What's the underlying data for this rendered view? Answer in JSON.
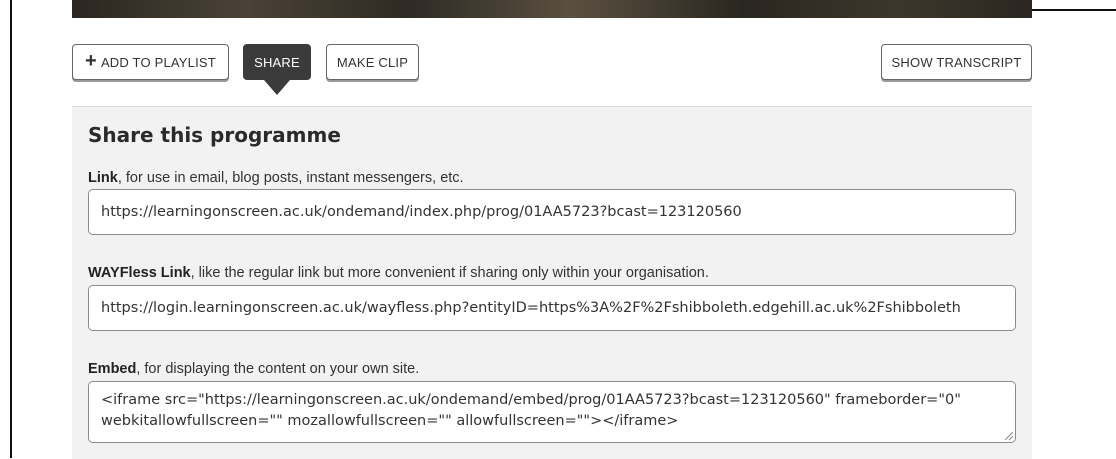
{
  "toolbar": {
    "add_label": "ADD TO PLAYLIST",
    "share_label": "SHARE",
    "clip_label": "MAKE CLIP",
    "transcript_label": "SHOW TRANSCRIPT"
  },
  "share": {
    "title": "Share this programme",
    "link": {
      "label_bold": "Link",
      "label_rest": ", for use in email, blog posts, instant messengers, etc.",
      "value": "https://learningonscreen.ac.uk/ondemand/index.php/prog/01AA5723?bcast=123120560"
    },
    "wayfless": {
      "label_bold": "WAYFless Link",
      "label_rest": ", like the regular link but more convenient if sharing only within your organisation.",
      "value": "https://login.learningonscreen.ac.uk/wayfless.php?entityID=https%3A%2F%2Fshibboleth.edgehill.ac.uk%2Fshibboleth"
    },
    "embed": {
      "label_bold": "Embed",
      "label_rest": ", for displaying the content on your own site.",
      "value": "<iframe src=\"https://learningonscreen.ac.uk/ondemand/embed/prog/01AA5723?bcast=123120560\" frameborder=\"0\" webkitallowfullscreen=\"\" mozallowfullscreen=\"\" allowfullscreen=\"\"></iframe>"
    }
  },
  "colors": {
    "panel_bg": "#f2f2f2",
    "active_button": "#3b3b3b"
  }
}
